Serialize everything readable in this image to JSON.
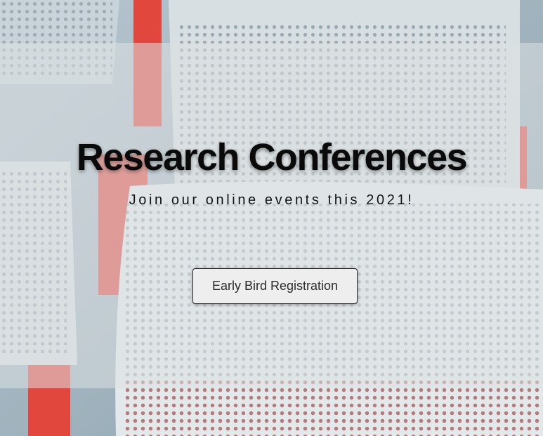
{
  "hero": {
    "title": "Research Conferences",
    "subtitle": "Join our online events this 2021!",
    "cta_label": "Early Bird Registration",
    "background_image": "auditorium-chairs-photo"
  },
  "colors": {
    "overlay": "#dce0e2",
    "title_text": "#0a0a0a",
    "button_bg": "#eeeeee",
    "button_border": "#2a2a2a",
    "accent_red": "#e2473d"
  }
}
